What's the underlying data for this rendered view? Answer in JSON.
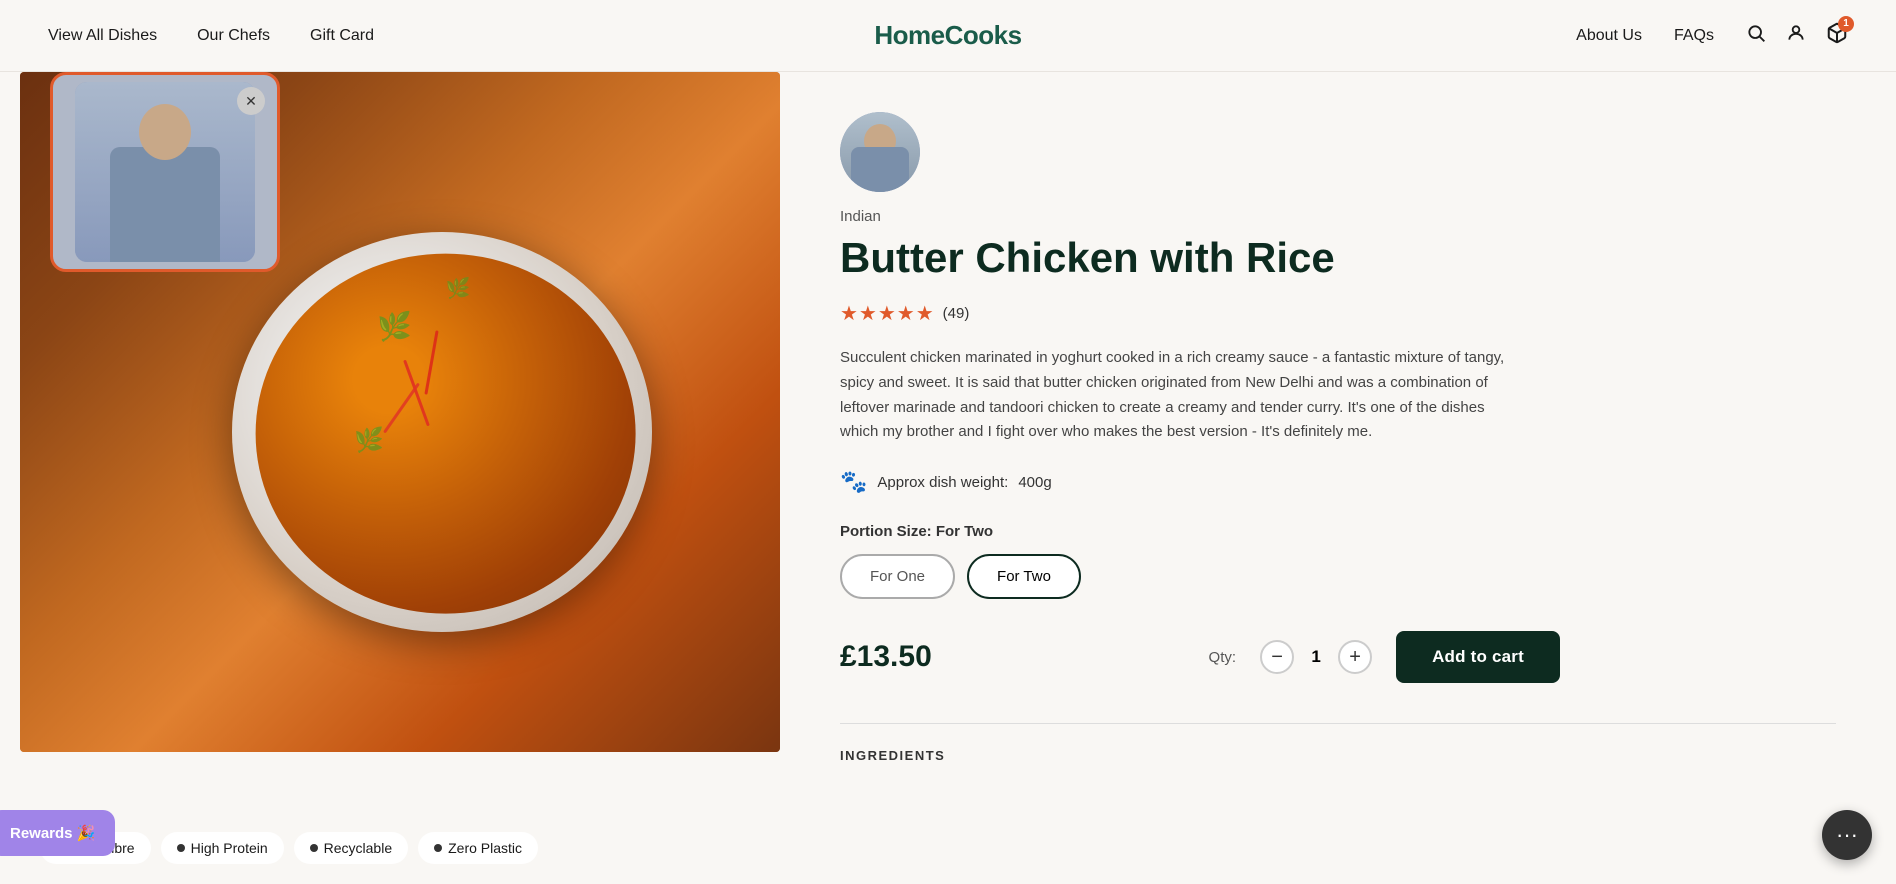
{
  "header": {
    "logo": "HomeCooks",
    "nav_left": [
      {
        "label": "View All Dishes",
        "key": "view-all-dishes"
      },
      {
        "label": "Our Chefs",
        "key": "our-chefs"
      },
      {
        "label": "Gift Card",
        "key": "gift-card"
      }
    ],
    "nav_right": [
      {
        "label": "About Us",
        "key": "about-us"
      },
      {
        "label": "FAQs",
        "key": "faqs"
      }
    ],
    "cart_count": "1"
  },
  "product": {
    "cuisine": "Indian",
    "title": "Butter Chicken with Rice",
    "rating_stars": "★★★★★",
    "rating_value": "4.9",
    "rating_count": "(49)",
    "description": "Succulent chicken marinated in yoghurt cooked in a rich creamy sauce - a fantastic mixture of tangy, spicy and sweet. It is said that butter chicken originated from New Delhi and was a combination of leftover marinade and tandoori chicken to create a creamy and tender curry. It's one of the dishes which my brother and I fight over who makes the best version - It's definitely me.",
    "dish_weight_label": "Approx dish weight:",
    "dish_weight_value": "400g",
    "portion_label": "Portion Size:",
    "portion_selected": "For Two",
    "portion_options": [
      {
        "label": "For One",
        "key": "for-one"
      },
      {
        "label": "For Two",
        "key": "for-two",
        "active": true
      }
    ],
    "price": "£13.50",
    "qty_label": "Qty:",
    "qty_value": "1",
    "qty_minus": "−",
    "qty_plus": "+",
    "add_to_cart": "Add to cart",
    "ingredients_heading": "INGREDIENTS"
  },
  "image_tags": [
    {
      "label": "High Fibre",
      "key": "high-fibre"
    },
    {
      "label": "High Protein",
      "key": "high-protein"
    },
    {
      "label": "Recyclable",
      "key": "recyclable"
    },
    {
      "label": "Zero Plastic",
      "key": "zero-plastic"
    }
  ],
  "rewards": {
    "label": "Rewards 🎉"
  },
  "chat": {
    "icon": "···"
  }
}
